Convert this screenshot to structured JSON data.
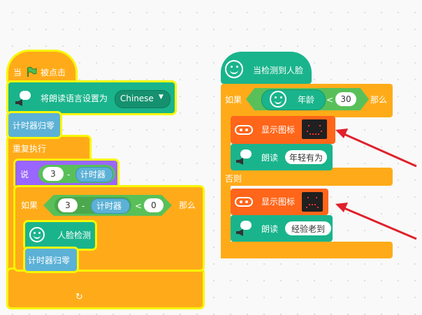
{
  "colors": {
    "orange": "#ffab19",
    "green": "#1ab48c",
    "teal": "#5cb1d6",
    "purple": "#9966ff",
    "red": "#ff661a",
    "glow": "#f7f700",
    "arrow": "#e0202b"
  },
  "left": {
    "hat_label_prefix": "当",
    "hat_label_suffix": "被点击",
    "set_voice_label": "将朗读语言设置为",
    "voice_value": "Chinese",
    "timer_reset_1": "计时器归零",
    "repeat_label": "重复执行",
    "say_label": "说",
    "say_num": "3",
    "say_minus": "-",
    "say_timer": "计时器",
    "if_label": "如果",
    "if_num": "3",
    "if_minus": "-",
    "if_timer": "计时器",
    "if_lt": "<",
    "if_zero": "0",
    "if_then": "那么",
    "face_detect": "人脸检测",
    "timer_reset_2": "计时器归零"
  },
  "right": {
    "hat_label": "当检测到人脸",
    "if_label": "如果",
    "age_label": "年龄",
    "lt": "<",
    "age_value": "30",
    "then_label": "那么",
    "show_icon_1": "显示图标",
    "read_1": "朗读",
    "read_1_value": "年轻有为",
    "else_label": "否则",
    "show_icon_2": "显示图标",
    "read_2": "朗读",
    "read_2_value": "经验老到"
  }
}
